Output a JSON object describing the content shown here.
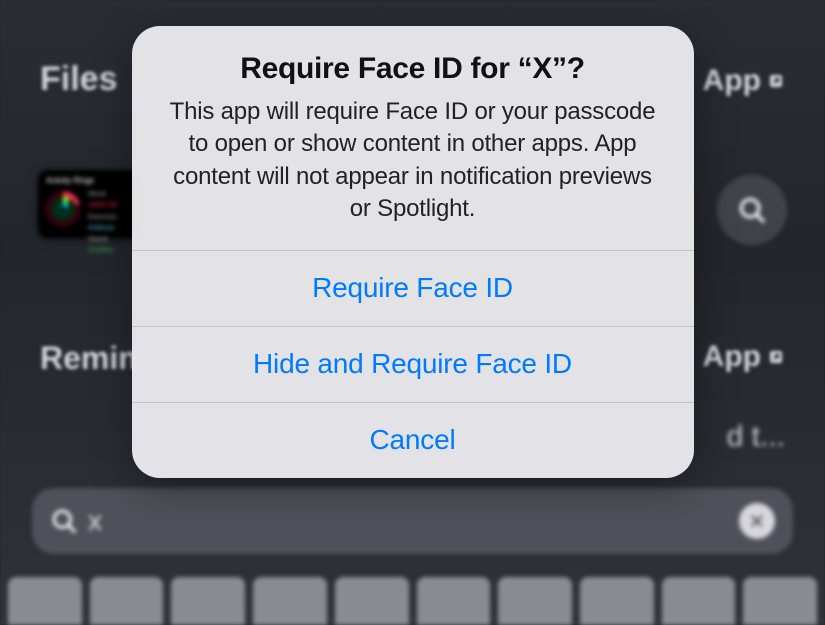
{
  "background": {
    "labels": {
      "files": "Files",
      "reminders": "Remin",
      "app1": "App",
      "app2": "App",
      "truncated": "d t..."
    },
    "widget": {
      "title": "Activity Rings",
      "move_label": "Move",
      "move_value": "190/2,50",
      "exercise_label": "Exercise",
      "exercise_value": "0/30min",
      "stand_label": "Stand",
      "stand_value": "1/12hrs"
    },
    "search": {
      "query": "x"
    }
  },
  "alert": {
    "title": "Require Face ID for “X”?",
    "message": "This app will require Face ID or your passcode to open or show content in other apps. App content will not appear in notification previews or Spotlight.",
    "actions": {
      "require": "Require Face ID",
      "hide_require": "Hide and Require Face ID",
      "cancel": "Cancel"
    }
  },
  "colors": {
    "accent": "#007aff"
  }
}
